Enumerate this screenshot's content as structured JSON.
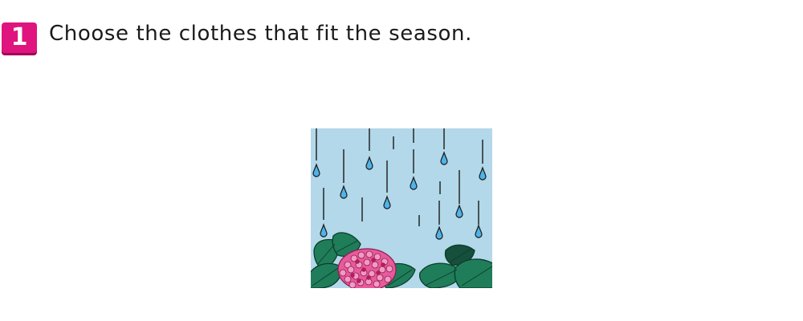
{
  "question": {
    "number": "1",
    "prompt": "Choose the clothes that fit the season."
  },
  "illustration": {
    "icon": "rainy-season-hydrangea-icon",
    "colors": {
      "sky": "#b2d8ea",
      "raindrop": "#4fb3e8",
      "leaf": "#1f7d5a",
      "flower": "#e85a9b",
      "badge": "#e0147e"
    }
  }
}
